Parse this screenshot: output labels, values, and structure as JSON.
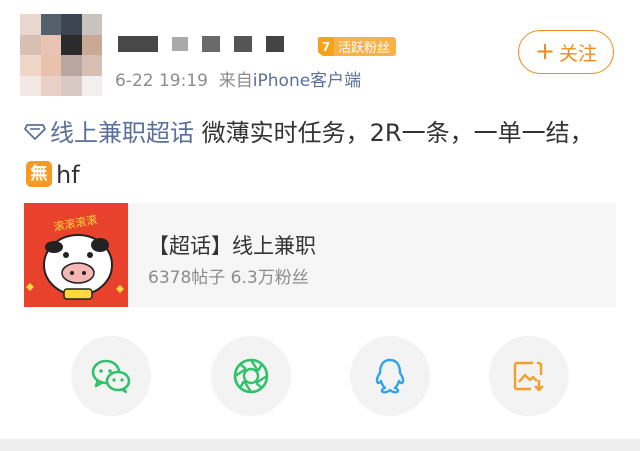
{
  "post": {
    "author": {
      "badge_level": "7",
      "badge_label": "活跃粉丝"
    },
    "timestamp": "6-22 19:19",
    "source_prefix": "来自",
    "source": "iPhone客户端",
    "follow_label": "关注",
    "body": {
      "topic": "线上兼职超话",
      "text": " 微薄实时任务，2R一条，一单一结，",
      "emoji_text": "無",
      "suffix": "hf"
    }
  },
  "card": {
    "title": "【超话】线上兼职",
    "posts_count": "6378帖子",
    "fans_count": "6.3万粉丝",
    "image_text": "滚滚滚滚"
  },
  "share": {
    "items": [
      {
        "name": "wechat",
        "icon": "wechat-icon"
      },
      {
        "name": "moments",
        "icon": "moments-icon"
      },
      {
        "name": "qq",
        "icon": "qq-icon"
      },
      {
        "name": "save-image",
        "icon": "save-image-icon"
      }
    ]
  },
  "colors": {
    "accent": "#f08a1d",
    "link": "#5b6f9b",
    "wechat": "#2fc26a",
    "qq": "#32a3e8",
    "save": "#f0a029"
  }
}
